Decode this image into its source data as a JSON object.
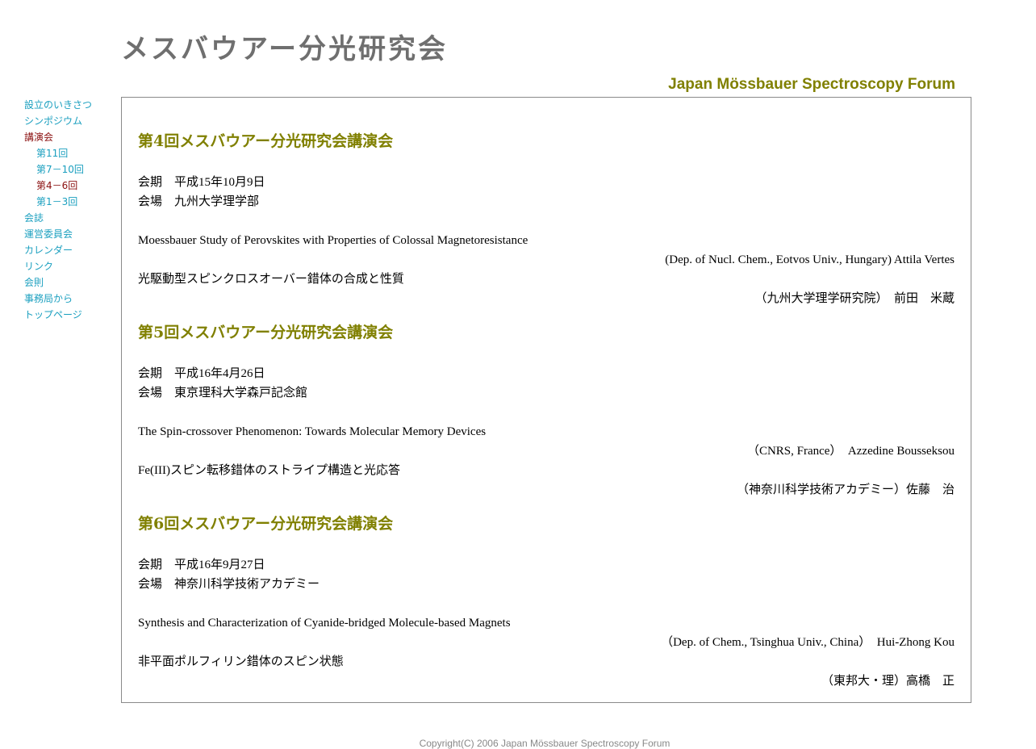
{
  "header": {
    "title": "メスバウアー分光研究会",
    "subtitle": "Japan Mössbauer Spectroscopy Forum"
  },
  "nav": {
    "items": [
      {
        "label": "設立のいきさつ",
        "level": 0,
        "active": false
      },
      {
        "label": "シンポジウム",
        "level": 0,
        "active": false
      },
      {
        "label": "講演会",
        "level": 0,
        "active": true
      },
      {
        "label": "第11回",
        "level": 1,
        "active": false
      },
      {
        "label": "第7－10回",
        "level": 1,
        "active": false
      },
      {
        "label": "第4－6回",
        "level": 1,
        "active": true
      },
      {
        "label": "第1－3回",
        "level": 1,
        "active": false
      },
      {
        "label": "会誌",
        "level": 0,
        "active": false
      },
      {
        "label": "運営委員会",
        "level": 0,
        "active": false
      },
      {
        "label": "カレンダー",
        "level": 0,
        "active": false
      },
      {
        "label": "リンク",
        "level": 0,
        "active": false
      },
      {
        "label": "会則",
        "level": 0,
        "active": false
      },
      {
        "label": "事務局から",
        "level": 0,
        "active": false
      },
      {
        "label": "トップページ",
        "level": 0,
        "active": false
      }
    ]
  },
  "sections": [
    {
      "heading": "第4回メスバウアー分光研究会講演会",
      "date": "会期　平成15年10月9日",
      "venue": "会場　九州大学理学部",
      "talks": [
        {
          "title": "Moessbauer Study of Perovskites with Properties of Colossal Magnetoresistance",
          "author": "(Dep. of Nucl. Chem., Eotvos Univ., Hungary) Attila Vertes"
        },
        {
          "title": "光駆動型スピンクロスオーバー錯体の合成と性質",
          "author": "（九州大学理学研究院）　前田　米蔵"
        }
      ]
    },
    {
      "heading": "第5回メスバウアー分光研究会講演会",
      "date": "会期　平成16年4月26日",
      "venue": "会場　東京理科大学森戸記念館",
      "talks": [
        {
          "title": "The Spin-crossover Phenomenon: Towards Molecular Memory Devices",
          "author": "（CNRS, France）　Azzedine Bousseksou"
        },
        {
          "title": "Fe(III)スピン転移錯体のストライプ構造と光応答",
          "author": "（神奈川科学技術アカデミー）佐藤　治"
        }
      ]
    },
    {
      "heading": "第6回メスバウアー分光研究会講演会",
      "date": "会期　平成16年9月27日",
      "venue": "会場　神奈川科学技術アカデミー",
      "talks": [
        {
          "title": "Synthesis and Characterization of Cyanide-bridged Molecule-based Magnets",
          "author": "（Dep. of Chem., Tsinghua Univ., China）　Hui-Zhong Kou"
        },
        {
          "title": "非平面ポルフィリン錯体のスピン状態",
          "author": "（東邦大・理）高橋　正"
        }
      ]
    }
  ],
  "footer": {
    "copyright": "Copyright(C) 2006 Japan Mössbauer Spectroscopy Forum"
  },
  "colors": {
    "title": "#6f6f6f",
    "accent": "#808000",
    "link": "#1a9fbf",
    "active_link": "#8b1010",
    "border": "#8a8a8a",
    "footer": "#888888"
  }
}
